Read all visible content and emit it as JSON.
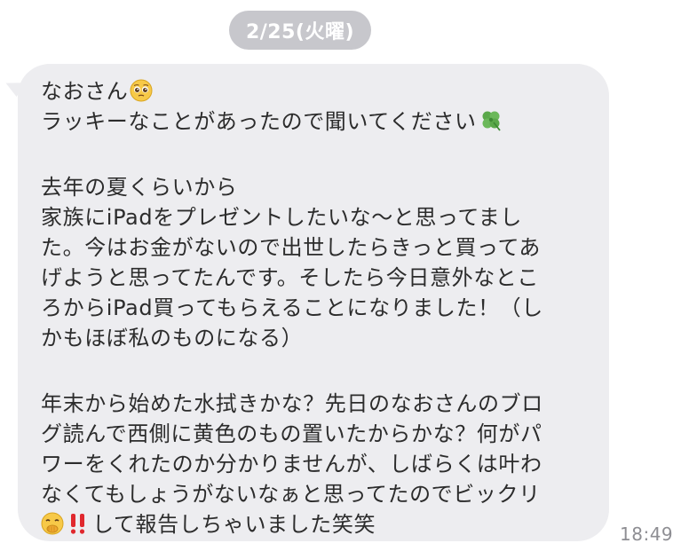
{
  "date_label": "2/25(火曜)",
  "message": {
    "line1": "なおさん",
    "line2": "ラッキーなことがあったので聞いてください",
    "line3": "去年の夏くらいから",
    "line4": "家族にiPadをプレゼントしたいな〜と思ってまし",
    "line5": "た。今はお金がないので出世したらきっと買ってあ",
    "line6": "げようと思ってたんです。そしたら今日意外なとこ",
    "line7": "ろからiPad買ってもらえることになりました！（し",
    "line8": "かもほぼ私のものになる）",
    "line9": "年末から始めた水拭きかな？先日のなおさんのブロ",
    "line10": "グ読んで西側に黄色のもの置いたからかな？何がパ",
    "line11": "ワーをくれたのか分かりませんが、しばらくは叶わ",
    "line12": "なくてもしょうがないなぁと思ってたのでビックリ",
    "line13": "して報告しちゃいました笑笑"
  },
  "icons": {
    "pleading_face": "pleading-face-emoji",
    "clover": "four-leaf-clover-emoji",
    "hand_over_mouth": "face-with-hand-over-mouth-emoji",
    "double_exclamation": "double-exclamation-emoji"
  },
  "timestamp": "18:49",
  "colors": {
    "bubble": "#ededf0",
    "date_pill": "#c7c7cc",
    "text": "#2c2c2c",
    "timestamp": "#8e8e93"
  }
}
